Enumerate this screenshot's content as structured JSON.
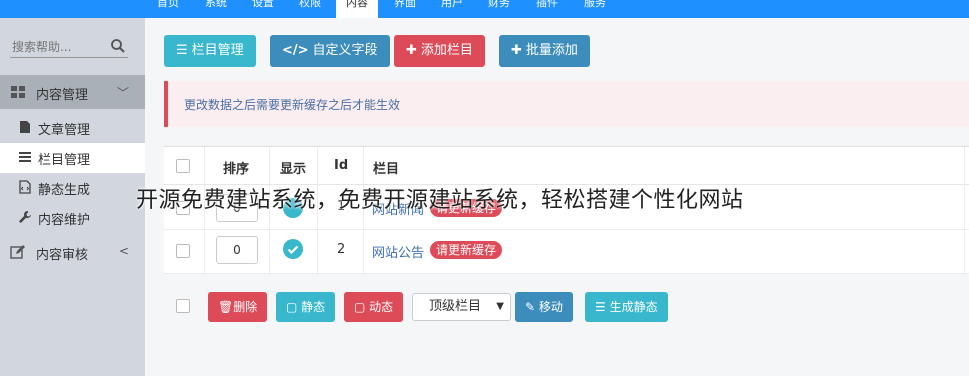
{
  "topnav": {
    "items": [
      "首页",
      "系统",
      "设置",
      "权限",
      "内容",
      "界面",
      "用户",
      "财务",
      "插件",
      "服务"
    ],
    "active_index": 4
  },
  "sidebar": {
    "search_placeholder": "搜索帮助...",
    "groups": [
      {
        "label": "内容管理",
        "icon": "grid-icon",
        "expanded": true,
        "items": [
          {
            "label": "文章管理",
            "icon": "file-icon"
          },
          {
            "label": "栏目管理",
            "icon": "list-icon",
            "active": true
          },
          {
            "label": "静态生成",
            "icon": "html-file-icon"
          },
          {
            "label": "内容维护",
            "icon": "wrench-icon"
          }
        ]
      },
      {
        "label": "内容审核",
        "icon": "edit-icon",
        "expanded": false
      }
    ]
  },
  "toolbar": {
    "column_manage": "栏目管理",
    "custom_fields": "自定义字段",
    "add_column": "添加栏目",
    "batch_add": "批量添加"
  },
  "notice": "更改数据之后需要更新缓存之后才能生效",
  "table": {
    "headers": {
      "sort": "排序",
      "display": "显示",
      "id": "Id",
      "column": "栏目"
    },
    "rows": [
      {
        "sort": "0",
        "id": "1",
        "name": "网站新闻",
        "badge": "请更新缓存"
      },
      {
        "sort": "0",
        "id": "2",
        "name": "网站公告",
        "badge": "请更新缓存"
      }
    ]
  },
  "bulk_actions": {
    "delete": "删除",
    "static": "静态",
    "dynamic": "动态",
    "select_value": "顶级栏目",
    "move": "移动",
    "generate_static": "生成静态"
  },
  "watermark": "开源免费建站系统，免费开源建站系统，轻松搭建个性化网站",
  "colors": {
    "nav_blue": "#1e90ff",
    "teal": "#39b7cd",
    "blue": "#3c8dbc",
    "red": "#dd4b59"
  }
}
